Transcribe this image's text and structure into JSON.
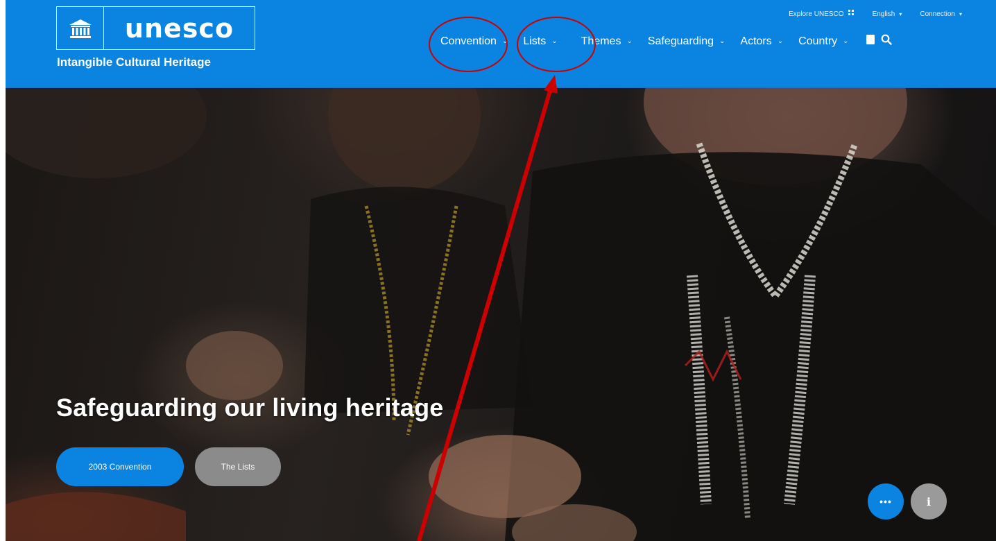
{
  "header": {
    "logo_text": "unesco",
    "tagline": "Intangible Cultural Heritage",
    "utility": [
      {
        "label": "Explore UNESCO",
        "icon": "grid-icon"
      },
      {
        "label": "English",
        "icon": "chevron-down-icon"
      },
      {
        "label": "Connection",
        "icon": "chevron-down-icon"
      }
    ],
    "nav": [
      {
        "label": "Convention"
      },
      {
        "label": "Lists"
      },
      {
        "label": "Themes"
      },
      {
        "label": "Safeguarding"
      },
      {
        "label": "Actors"
      },
      {
        "label": "Country"
      }
    ],
    "icons": [
      "bookmark-icon",
      "search-icon"
    ]
  },
  "hero": {
    "title": "Safeguarding our living heritage",
    "primary_button": "2003 Convention",
    "secondary_button": "The Lists",
    "more_button": "•••",
    "info_button": "i"
  },
  "colors": {
    "brand_blue": "#0a84e0",
    "annotation_red": "#cc0000",
    "secondary_gray": "#8b8b8b"
  }
}
